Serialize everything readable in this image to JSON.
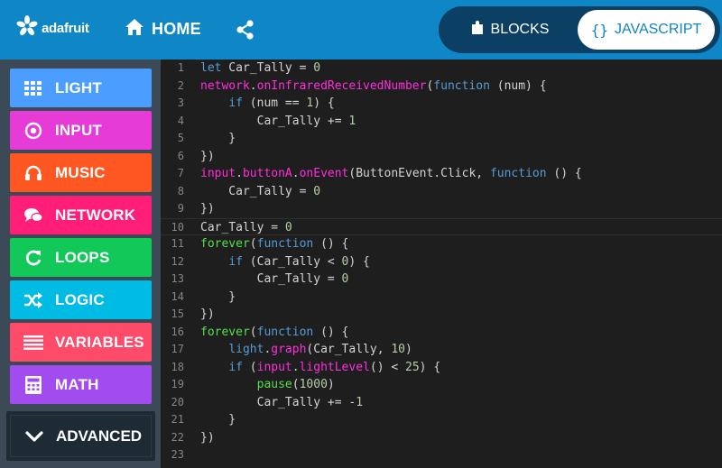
{
  "header": {
    "brand": "adafruit",
    "home_label": "HOME",
    "share_icon": "share-icon",
    "mode_toggle": {
      "blocks_label": "BLOCKS",
      "javascript_label": "JAVASCRIPT",
      "javascript_braces": "{}",
      "selected": "JAVASCRIPT"
    },
    "colors": {
      "bar": "#0f86c6",
      "toggle_bg": "#0b3f63"
    }
  },
  "sidebar": {
    "categories": [
      {
        "label": "LIGHT",
        "icon": "grid-icon",
        "color": "#4b9eff"
      },
      {
        "label": "INPUT",
        "icon": "target-icon",
        "color": "#e63bd6"
      },
      {
        "label": "MUSIC",
        "icon": "headphones-icon",
        "color": "#ff5722"
      },
      {
        "label": "NETWORK",
        "icon": "chat-icon",
        "color": "#ff1f78"
      },
      {
        "label": "LOOPS",
        "icon": "refresh-icon",
        "color": "#11c858"
      },
      {
        "label": "LOGIC",
        "icon": "shuffle-icon",
        "color": "#00bce4"
      },
      {
        "label": "VARIABLES",
        "icon": "list-icon",
        "color": "#ff4b6a"
      },
      {
        "label": "MATH",
        "icon": "calculator-icon",
        "color": "#a24cf0"
      }
    ],
    "advanced": {
      "label": "ADVANCED",
      "icon": "chevron-down-icon"
    }
  },
  "editor": {
    "lines": [
      {
        "n": "1",
        "tokens": [
          [
            "k",
            "let"
          ],
          [
            "d",
            " Car_Tally = "
          ],
          [
            "n",
            "0"
          ]
        ]
      },
      {
        "n": "2",
        "tokens": [
          [
            "f",
            "network"
          ],
          [
            "d",
            "."
          ],
          [
            "f",
            "onInfraredReceivedNumber"
          ],
          [
            "d",
            "("
          ],
          [
            "k",
            "function"
          ],
          [
            "d",
            " (num) {"
          ]
        ]
      },
      {
        "n": "3",
        "tokens": [
          [
            "d",
            "    "
          ],
          [
            "k",
            "if"
          ],
          [
            "d",
            " (num == "
          ],
          [
            "n",
            "1"
          ],
          [
            "d",
            ") {"
          ]
        ]
      },
      {
        "n": "4",
        "tokens": [
          [
            "d",
            "        Car_Tally += "
          ],
          [
            "n",
            "1"
          ]
        ]
      },
      {
        "n": "5",
        "tokens": [
          [
            "d",
            "    }"
          ]
        ]
      },
      {
        "n": "6",
        "tokens": [
          [
            "d",
            "})"
          ]
        ]
      },
      {
        "n": "7",
        "tokens": [
          [
            "f",
            "input"
          ],
          [
            "d",
            "."
          ],
          [
            "f",
            "buttonA"
          ],
          [
            "d",
            "."
          ],
          [
            "f",
            "onEvent"
          ],
          [
            "d",
            "(ButtonEvent.Click, "
          ],
          [
            "k",
            "function"
          ],
          [
            "d",
            " () {"
          ]
        ]
      },
      {
        "n": "8",
        "tokens": [
          [
            "d",
            "    Car_Tally = "
          ],
          [
            "n",
            "0"
          ]
        ]
      },
      {
        "n": "9",
        "tokens": [
          [
            "d",
            "})"
          ]
        ]
      },
      {
        "n": "10",
        "tokens": [
          [
            "d",
            "Car_Tally = "
          ],
          [
            "n",
            "0"
          ]
        ]
      },
      {
        "n": "11",
        "tokens": [
          [
            "g",
            "forever"
          ],
          [
            "d",
            "("
          ],
          [
            "k",
            "function"
          ],
          [
            "d",
            " () {"
          ]
        ]
      },
      {
        "n": "12",
        "tokens": [
          [
            "d",
            "    "
          ],
          [
            "k",
            "if"
          ],
          [
            "d",
            " (Car_Tally < "
          ],
          [
            "n",
            "0"
          ],
          [
            "d",
            ") {"
          ]
        ]
      },
      {
        "n": "13",
        "tokens": [
          [
            "d",
            "        Car_Tally = "
          ],
          [
            "n",
            "0"
          ]
        ]
      },
      {
        "n": "14",
        "tokens": [
          [
            "d",
            "    }"
          ]
        ]
      },
      {
        "n": "15",
        "tokens": [
          [
            "d",
            "})"
          ]
        ]
      },
      {
        "n": "16",
        "tokens": [
          [
            "g",
            "forever"
          ],
          [
            "d",
            "("
          ],
          [
            "k",
            "function"
          ],
          [
            "d",
            " () {"
          ]
        ]
      },
      {
        "n": "17",
        "tokens": [
          [
            "d",
            "    "
          ],
          [
            "k",
            "light"
          ],
          [
            "d",
            "."
          ],
          [
            "f",
            "graph"
          ],
          [
            "d",
            "(Car_Tally, "
          ],
          [
            "n",
            "10"
          ],
          [
            "d",
            ")"
          ]
        ]
      },
      {
        "n": "18",
        "tokens": [
          [
            "d",
            "    "
          ],
          [
            "k",
            "if"
          ],
          [
            "d",
            " ("
          ],
          [
            "f",
            "input"
          ],
          [
            "d",
            "."
          ],
          [
            "f",
            "lightLevel"
          ],
          [
            "d",
            "() < "
          ],
          [
            "n",
            "25"
          ],
          [
            "d",
            ") {"
          ]
        ]
      },
      {
        "n": "19",
        "tokens": [
          [
            "d",
            "        "
          ],
          [
            "g",
            "pause"
          ],
          [
            "d",
            "("
          ],
          [
            "n",
            "1000"
          ],
          [
            "d",
            ")"
          ]
        ]
      },
      {
        "n": "20",
        "tokens": [
          [
            "d",
            "        Car_Tally += -"
          ],
          [
            "n",
            "1"
          ]
        ]
      },
      {
        "n": "21",
        "tokens": [
          [
            "d",
            "    }"
          ]
        ]
      },
      {
        "n": "22",
        "tokens": [
          [
            "d",
            "})"
          ]
        ]
      },
      {
        "n": "23",
        "tokens": []
      }
    ],
    "current_line": "10"
  }
}
